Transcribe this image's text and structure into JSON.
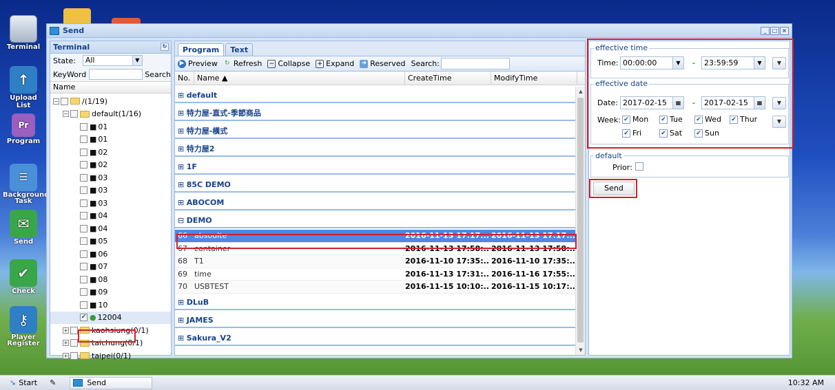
{
  "dock": {
    "items": [
      {
        "label": "Terminal",
        "icon": "monitor-icon"
      },
      {
        "label": "Upload List",
        "icon": "upload-arrow-icon"
      },
      {
        "label": "Program",
        "icon": "premiere-icon",
        "glyph": "Pr"
      },
      {
        "label": "Background Task",
        "icon": "task-list-icon"
      },
      {
        "label": "Send",
        "icon": "send-icon"
      },
      {
        "label": "Check",
        "icon": "checkmark-icon"
      },
      {
        "label": "Player Register",
        "icon": "key-icon"
      }
    ]
  },
  "window": {
    "title": "Send",
    "controls": [
      "_",
      "□",
      "×"
    ]
  },
  "terminal": {
    "title": "Terminal",
    "state_label": "State:",
    "state_value": "All",
    "keyword_label": "KeyWord",
    "search_button": "Search",
    "name_column": "Name",
    "tree": [
      {
        "label": "/(1/19)",
        "level": 0,
        "type": "folder",
        "expand": "−"
      },
      {
        "label": "default(1/16)",
        "level": 1,
        "type": "folder",
        "expand": "−"
      },
      {
        "label": "01",
        "level": 2,
        "type": "device"
      },
      {
        "label": "01",
        "level": 2,
        "type": "device"
      },
      {
        "label": "02",
        "level": 2,
        "type": "device"
      },
      {
        "label": "02",
        "level": 2,
        "type": "device"
      },
      {
        "label": "03",
        "level": 2,
        "type": "device"
      },
      {
        "label": "03",
        "level": 2,
        "type": "device"
      },
      {
        "label": "03",
        "level": 2,
        "type": "device"
      },
      {
        "label": "04",
        "level": 2,
        "type": "device"
      },
      {
        "label": "04",
        "level": 2,
        "type": "device"
      },
      {
        "label": "05",
        "level": 2,
        "type": "device"
      },
      {
        "label": "06",
        "level": 2,
        "type": "device"
      },
      {
        "label": "07",
        "level": 2,
        "type": "device"
      },
      {
        "label": "08",
        "level": 2,
        "type": "device"
      },
      {
        "label": "09",
        "level": 2,
        "type": "device"
      },
      {
        "label": "10",
        "level": 2,
        "type": "device"
      },
      {
        "label": "12004",
        "level": 2,
        "type": "device-online",
        "checked": true
      },
      {
        "label": "kaohsiung(0/1)",
        "level": 1,
        "type": "folder",
        "expand": "+"
      },
      {
        "label": "taichung(0/1)",
        "level": 1,
        "type": "folder",
        "expand": "+"
      },
      {
        "label": "taipei(0/1)",
        "level": 1,
        "type": "folder",
        "expand": "+"
      }
    ]
  },
  "program": {
    "tabs": [
      "Program",
      "Text"
    ],
    "toolbar": {
      "preview": "Preview",
      "refresh": "Refresh",
      "collapse": "Collapse",
      "expand": "Expand",
      "reserved": "Reserved",
      "search_label": "Search:"
    },
    "columns": {
      "no": "No.",
      "name": "Name ▲",
      "create": "CreateTime",
      "modify": "ModifyTime"
    },
    "groups_before": [
      "default",
      "特力屋-直式-季節商品",
      "特力屋-橫式",
      "特力屋2",
      "1F",
      "85C DEMO",
      "ABOCOM"
    ],
    "open_group": "DEMO",
    "rows": [
      {
        "no": "66",
        "name": "absoulte",
        "create": "2016-11-13 17:17:...",
        "modify": "2016-11-13 17:17:..."
      },
      {
        "no": "67",
        "name": "container",
        "create": "2016-11-13 17:58:...",
        "modify": "2016-11-13 17:58:..."
      },
      {
        "no": "68",
        "name": "T1",
        "create": "2016-11-10 17:35:...",
        "modify": "2016-11-10 17:35:..."
      },
      {
        "no": "69",
        "name": "time",
        "create": "2016-11-13 17:31:...",
        "modify": "2016-11-16 17:55:..."
      },
      {
        "no": "70",
        "name": "USBTEST",
        "create": "2016-11-15 10:10:...",
        "modify": "2016-11-15 10:17:..."
      }
    ],
    "groups_after": [
      "DLuB",
      "JAMES",
      "Sakura_V2"
    ]
  },
  "settings": {
    "effective_time": {
      "legend": "effective time",
      "time_label": "Time:",
      "start": "00:00:00",
      "sep": "-",
      "end": "23:59:59"
    },
    "effective_date": {
      "legend": "effective date",
      "date_label": "Date:",
      "start": "2017-02-15",
      "sep": "-",
      "end": "2017-02-15",
      "week_label": "Week:",
      "days": [
        "Mon",
        "Tue",
        "Wed",
        "Thur",
        "Fri",
        "Sat",
        "Sun"
      ]
    },
    "default": {
      "legend": "default",
      "prior_label": "Prior:"
    },
    "send_button": "Send"
  },
  "taskbar": {
    "start": "Start",
    "window": "Send",
    "clock": "10:32 AM"
  },
  "colors": {
    "highlight": "#d0202a",
    "selected_row": "#4f87e1",
    "panel_border": "#99bbe8"
  }
}
